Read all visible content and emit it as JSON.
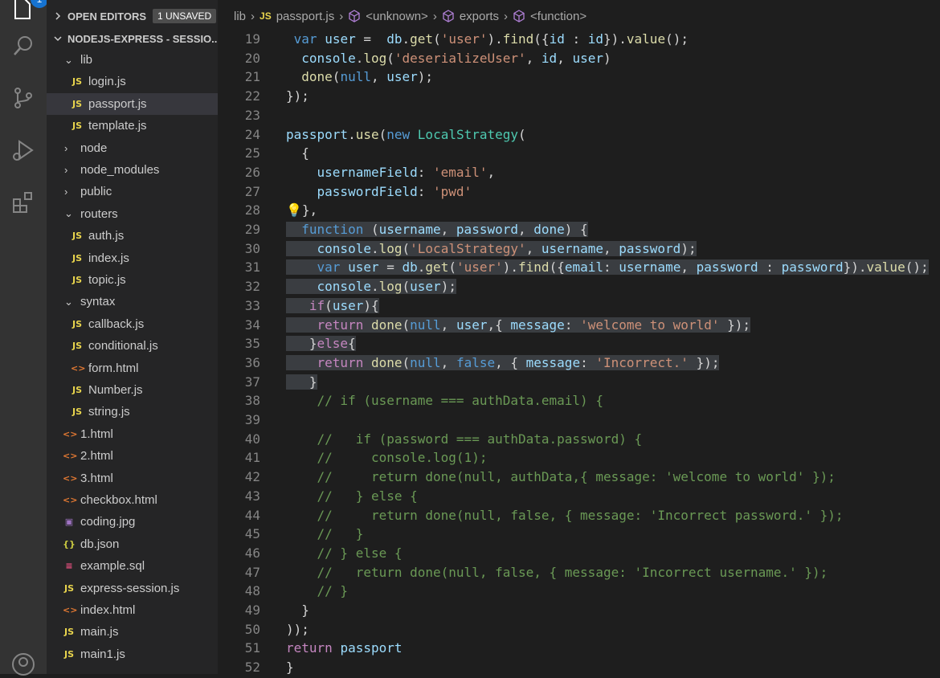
{
  "activity_bar": {
    "badge": "1",
    "icons": [
      "explorer-icon",
      "search-icon",
      "source-control-icon",
      "run-debug-icon",
      "extensions-icon",
      "account-icon"
    ]
  },
  "sidebar": {
    "open_editors_label": "OPEN EDITORS",
    "unsaved_label": "1 UNSAVED",
    "project_label": "NODEJS-EXPRESS - SESSIO...",
    "items": [
      {
        "label": "lib",
        "type": "folder",
        "depth": 1,
        "expanded": true
      },
      {
        "label": "login.js",
        "type": "js",
        "depth": 2
      },
      {
        "label": "passport.js",
        "type": "js",
        "depth": 2,
        "active": true
      },
      {
        "label": "template.js",
        "type": "js",
        "depth": 2
      },
      {
        "label": "node",
        "type": "folder",
        "depth": 1,
        "expanded": false
      },
      {
        "label": "node_modules",
        "type": "folder",
        "depth": 1,
        "expanded": false
      },
      {
        "label": "public",
        "type": "folder",
        "depth": 1,
        "expanded": false
      },
      {
        "label": "routers",
        "type": "folder",
        "depth": 1,
        "expanded": true
      },
      {
        "label": "auth.js",
        "type": "js",
        "depth": 2
      },
      {
        "label": "index.js",
        "type": "js",
        "depth": 2
      },
      {
        "label": "topic.js",
        "type": "js",
        "depth": 2
      },
      {
        "label": "syntax",
        "type": "folder",
        "depth": 1,
        "expanded": true
      },
      {
        "label": "callback.js",
        "type": "js",
        "depth": 2
      },
      {
        "label": "conditional.js",
        "type": "js",
        "depth": 2
      },
      {
        "label": "form.html",
        "type": "html",
        "depth": 2
      },
      {
        "label": "Number.js",
        "type": "js",
        "depth": 2
      },
      {
        "label": "string.js",
        "type": "js",
        "depth": 2
      },
      {
        "label": "1.html",
        "type": "html",
        "depth": 1
      },
      {
        "label": "2.html",
        "type": "html",
        "depth": 1
      },
      {
        "label": "3.html",
        "type": "html",
        "depth": 1
      },
      {
        "label": "checkbox.html",
        "type": "html",
        "depth": 1
      },
      {
        "label": "coding.jpg",
        "type": "img",
        "depth": 1
      },
      {
        "label": "db.json",
        "type": "json",
        "depth": 1
      },
      {
        "label": "example.sql",
        "type": "sql",
        "depth": 1
      },
      {
        "label": "express-session.js",
        "type": "js",
        "depth": 1
      },
      {
        "label": "index.html",
        "type": "html",
        "depth": 1
      },
      {
        "label": "main.js",
        "type": "js",
        "depth": 1
      },
      {
        "label": "main1.js",
        "type": "js",
        "depth": 1
      }
    ]
  },
  "breadcrumb": {
    "folder": "lib",
    "file_badge": "JS",
    "file": "passport.js",
    "symbols": [
      "<unknown>",
      "exports",
      "<function>"
    ]
  },
  "editor": {
    "lines": [
      {
        "n": "19",
        "sel": false,
        "tokens": [
          [
            "",
            " "
          ],
          [
            "kw",
            "var"
          ],
          [
            "",
            " "
          ],
          [
            "var",
            "user"
          ],
          [
            "",
            " =  "
          ],
          [
            "var",
            "db"
          ],
          [
            "",
            "."
          ],
          [
            "fn",
            "get"
          ],
          [
            "",
            "("
          ],
          [
            "str",
            "'user'"
          ],
          [
            "",
            ")."
          ],
          [
            "fn",
            "find"
          ],
          [
            "",
            "({"
          ],
          [
            "var",
            "id"
          ],
          [
            "",
            " : "
          ],
          [
            "var",
            "id"
          ],
          [
            "",
            "})."
          ],
          [
            "fn",
            "value"
          ],
          [
            "",
            "();"
          ]
        ]
      },
      {
        "n": "20",
        "sel": false,
        "tokens": [
          [
            "",
            "  "
          ],
          [
            "var",
            "console"
          ],
          [
            "",
            "."
          ],
          [
            "fn",
            "log"
          ],
          [
            "",
            "("
          ],
          [
            "str",
            "'deserializeUser'"
          ],
          [
            "",
            ", "
          ],
          [
            "var",
            "id"
          ],
          [
            "",
            ", "
          ],
          [
            "var",
            "user"
          ],
          [
            "",
            ")"
          ]
        ]
      },
      {
        "n": "21",
        "sel": false,
        "tokens": [
          [
            "",
            "  "
          ],
          [
            "fn",
            "done"
          ],
          [
            "",
            "("
          ],
          [
            "kw",
            "null"
          ],
          [
            "",
            ", "
          ],
          [
            "var",
            "user"
          ],
          [
            "",
            ");"
          ]
        ]
      },
      {
        "n": "22",
        "sel": false,
        "tokens": [
          [
            "",
            "});"
          ]
        ]
      },
      {
        "n": "23",
        "sel": false,
        "tokens": [
          [
            "",
            ""
          ]
        ]
      },
      {
        "n": "24",
        "sel": false,
        "tokens": [
          [
            "var",
            "passport"
          ],
          [
            "",
            "."
          ],
          [
            "fn",
            "use"
          ],
          [
            "",
            "("
          ],
          [
            "kw",
            "new"
          ],
          [
            "",
            " "
          ],
          [
            "cls",
            "LocalStrategy"
          ],
          [
            "",
            "("
          ]
        ]
      },
      {
        "n": "25",
        "sel": false,
        "tokens": [
          [
            "",
            "  {"
          ]
        ]
      },
      {
        "n": "26",
        "sel": false,
        "tokens": [
          [
            "",
            "    "
          ],
          [
            "var",
            "usernameField"
          ],
          [
            "",
            ": "
          ],
          [
            "str",
            "'email'"
          ],
          [
            "",
            ","
          ]
        ]
      },
      {
        "n": "27",
        "sel": false,
        "tokens": [
          [
            "",
            "    "
          ],
          [
            "var",
            "passwordField"
          ],
          [
            "",
            ": "
          ],
          [
            "str",
            "'pwd'"
          ]
        ]
      },
      {
        "n": "28",
        "sel": false,
        "tokens": [
          [
            "bulb",
            "💡"
          ],
          [
            "",
            "},"
          ]
        ]
      },
      {
        "n": "29",
        "sel": true,
        "tokens": [
          [
            "",
            "  "
          ],
          [
            "kw",
            "function"
          ],
          [
            "",
            " ("
          ],
          [
            "var",
            "username"
          ],
          [
            "",
            ", "
          ],
          [
            "var",
            "password"
          ],
          [
            "",
            ", "
          ],
          [
            "var",
            "done"
          ],
          [
            "",
            ") {"
          ]
        ]
      },
      {
        "n": "30",
        "sel": true,
        "tokens": [
          [
            "",
            "    "
          ],
          [
            "var",
            "console"
          ],
          [
            "",
            "."
          ],
          [
            "fn",
            "log"
          ],
          [
            "",
            "("
          ],
          [
            "str",
            "'LocalStrategy'"
          ],
          [
            "",
            ", "
          ],
          [
            "var",
            "username"
          ],
          [
            "",
            ", "
          ],
          [
            "var",
            "password"
          ],
          [
            "",
            ");"
          ]
        ]
      },
      {
        "n": "31",
        "sel": true,
        "tokens": [
          [
            "",
            "    "
          ],
          [
            "kw",
            "var"
          ],
          [
            "",
            " "
          ],
          [
            "var",
            "user"
          ],
          [
            "",
            " = "
          ],
          [
            "var",
            "db"
          ],
          [
            "",
            "."
          ],
          [
            "fn",
            "get"
          ],
          [
            "",
            "("
          ],
          [
            "str",
            "'user'"
          ],
          [
            "",
            ")."
          ],
          [
            "fn",
            "find"
          ],
          [
            "",
            "({"
          ],
          [
            "var",
            "email"
          ],
          [
            "",
            ": "
          ],
          [
            "var",
            "username"
          ],
          [
            "",
            ", "
          ],
          [
            "var",
            "password"
          ],
          [
            "",
            " : "
          ],
          [
            "var",
            "password"
          ],
          [
            "",
            "})."
          ],
          [
            "fn",
            "value"
          ],
          [
            "",
            "();"
          ]
        ]
      },
      {
        "n": "32",
        "sel": true,
        "tokens": [
          [
            "",
            "    "
          ],
          [
            "var",
            "console"
          ],
          [
            "",
            "."
          ],
          [
            "fn",
            "log"
          ],
          [
            "",
            "("
          ],
          [
            "var",
            "user"
          ],
          [
            "",
            ");"
          ]
        ]
      },
      {
        "n": "33",
        "sel": true,
        "tokens": [
          [
            "",
            "   "
          ],
          [
            "kw2",
            "if"
          ],
          [
            "",
            "("
          ],
          [
            "var",
            "user"
          ],
          [
            "",
            "){"
          ]
        ]
      },
      {
        "n": "34",
        "sel": true,
        "tokens": [
          [
            "",
            "    "
          ],
          [
            "kw2",
            "return"
          ],
          [
            "",
            " "
          ],
          [
            "fn",
            "done"
          ],
          [
            "",
            "("
          ],
          [
            "kw",
            "null"
          ],
          [
            "",
            ", "
          ],
          [
            "var",
            "user"
          ],
          [
            "",
            ",{ "
          ],
          [
            "var",
            "message"
          ],
          [
            "",
            ": "
          ],
          [
            "str",
            "'welcome to world'"
          ],
          [
            "",
            " });"
          ]
        ]
      },
      {
        "n": "35",
        "sel": true,
        "tokens": [
          [
            "",
            "   }"
          ],
          [
            "kw2",
            "else"
          ],
          [
            "",
            "{"
          ]
        ]
      },
      {
        "n": "36",
        "sel": true,
        "tokens": [
          [
            "",
            "    "
          ],
          [
            "kw2",
            "return"
          ],
          [
            "",
            " "
          ],
          [
            "fn",
            "done"
          ],
          [
            "",
            "("
          ],
          [
            "kw",
            "null"
          ],
          [
            "",
            ", "
          ],
          [
            "kw",
            "false"
          ],
          [
            "",
            ", { "
          ],
          [
            "var",
            "message"
          ],
          [
            "",
            ": "
          ],
          [
            "str",
            "'Incorrect.'"
          ],
          [
            "",
            " });"
          ]
        ]
      },
      {
        "n": "37",
        "sel": true,
        "tokens": [
          [
            "",
            "   }"
          ]
        ]
      },
      {
        "n": "38",
        "sel": false,
        "tokens": [
          [
            "",
            "    "
          ],
          [
            "cm",
            "// if (username === authData.email) {"
          ]
        ]
      },
      {
        "n": "39",
        "sel": false,
        "tokens": [
          [
            "",
            ""
          ]
        ]
      },
      {
        "n": "40",
        "sel": false,
        "tokens": [
          [
            "",
            "    "
          ],
          [
            "cm",
            "//   if (password === authData.password) {"
          ]
        ]
      },
      {
        "n": "41",
        "sel": false,
        "tokens": [
          [
            "",
            "    "
          ],
          [
            "cm",
            "//     console.log(1);"
          ]
        ]
      },
      {
        "n": "42",
        "sel": false,
        "tokens": [
          [
            "",
            "    "
          ],
          [
            "cm",
            "//     return done(null, authData,{ message: 'welcome to world' });"
          ]
        ]
      },
      {
        "n": "43",
        "sel": false,
        "tokens": [
          [
            "",
            "    "
          ],
          [
            "cm",
            "//   } else {"
          ]
        ]
      },
      {
        "n": "44",
        "sel": false,
        "tokens": [
          [
            "",
            "    "
          ],
          [
            "cm",
            "//     return done(null, false, { message: 'Incorrect password.' });"
          ]
        ]
      },
      {
        "n": "45",
        "sel": false,
        "tokens": [
          [
            "",
            "    "
          ],
          [
            "cm",
            "//   }"
          ]
        ]
      },
      {
        "n": "46",
        "sel": false,
        "tokens": [
          [
            "",
            "    "
          ],
          [
            "cm",
            "// } else {"
          ]
        ]
      },
      {
        "n": "47",
        "sel": false,
        "tokens": [
          [
            "",
            "    "
          ],
          [
            "cm",
            "//   return done(null, false, { message: 'Incorrect username.' });"
          ]
        ]
      },
      {
        "n": "48",
        "sel": false,
        "tokens": [
          [
            "",
            "    "
          ],
          [
            "cm",
            "// }"
          ]
        ]
      },
      {
        "n": "49",
        "sel": false,
        "tokens": [
          [
            "",
            "  }"
          ]
        ]
      },
      {
        "n": "50",
        "sel": false,
        "tokens": [
          [
            "",
            "));"
          ]
        ]
      },
      {
        "n": "51",
        "sel": false,
        "tokens": [
          [
            "kw2",
            "return"
          ],
          [
            "",
            " "
          ],
          [
            "var",
            "passport"
          ]
        ]
      },
      {
        "n": "52",
        "sel": false,
        "tokens": [
          [
            "",
            "}"
          ]
        ]
      }
    ]
  }
}
